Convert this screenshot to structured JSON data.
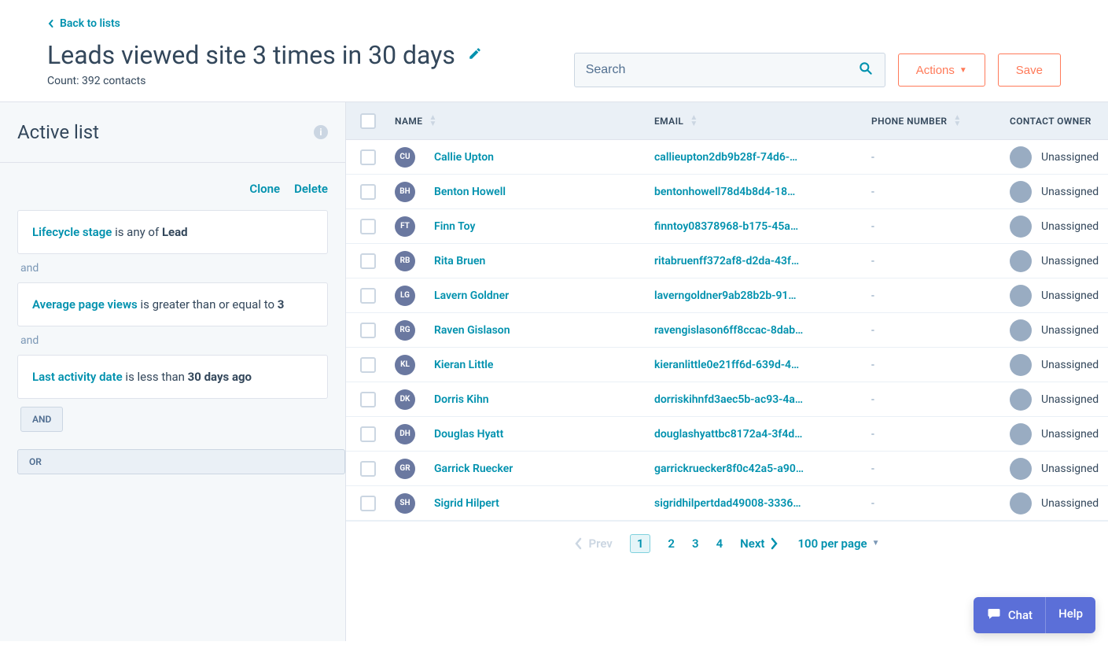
{
  "header": {
    "back_label": "Back to lists",
    "title": "Leads viewed site 3 times in 30 days",
    "count_text": "Count: 392 contacts",
    "search_placeholder": "Search",
    "actions_label": "Actions",
    "save_label": "Save"
  },
  "sidebar": {
    "title": "Active list",
    "clone_label": "Clone",
    "delete_label": "Delete",
    "filters": [
      {
        "property": "Lifecycle stage",
        "operator": " is any of ",
        "value": "Lead"
      },
      {
        "property": "Average page views",
        "operator": " is greater than or equal to ",
        "value": "3"
      },
      {
        "property": "Last activity date",
        "operator": " is less than ",
        "value": "30 days ago"
      }
    ],
    "connector_and": "and",
    "add_and_label": "AND",
    "add_or_label": "OR"
  },
  "table": {
    "columns": {
      "name": "NAME",
      "email": "EMAIL",
      "phone": "PHONE NUMBER",
      "owner": "CONTACT OWNER"
    },
    "rows": [
      {
        "initials": "CU",
        "name": "Callie Upton",
        "email": "callieupton2db9b28f-74d6-…",
        "phone": "-",
        "owner": "Unassigned"
      },
      {
        "initials": "BH",
        "name": "Benton Howell",
        "email": "bentonhowell78d4b8d4-18…",
        "phone": "-",
        "owner": "Unassigned"
      },
      {
        "initials": "FT",
        "name": "Finn Toy",
        "email": "finntoy08378968-b175-45a…",
        "phone": "-",
        "owner": "Unassigned"
      },
      {
        "initials": "RB",
        "name": "Rita Bruen",
        "email": "ritabruenff372af8-d2da-43f…",
        "phone": "-",
        "owner": "Unassigned"
      },
      {
        "initials": "LG",
        "name": "Lavern Goldner",
        "email": "laverngoldner9ab28b2b-91…",
        "phone": "-",
        "owner": "Unassigned"
      },
      {
        "initials": "RG",
        "name": "Raven Gislason",
        "email": "ravengislason6ff8ccac-8dab…",
        "phone": "-",
        "owner": "Unassigned"
      },
      {
        "initials": "KL",
        "name": "Kieran Little",
        "email": "kieranlittle0e21ff6d-639d-4…",
        "phone": "-",
        "owner": "Unassigned"
      },
      {
        "initials": "DK",
        "name": "Dorris Kihn",
        "email": "dorriskihnfd3aec5b-ac93-4a…",
        "phone": "-",
        "owner": "Unassigned"
      },
      {
        "initials": "DH",
        "name": "Douglas Hyatt",
        "email": "douglashyattbc8172a4-3f4d…",
        "phone": "-",
        "owner": "Unassigned"
      },
      {
        "initials": "GR",
        "name": "Garrick Ruecker",
        "email": "garrickruecker8f0c42a5-a90…",
        "phone": "-",
        "owner": "Unassigned"
      },
      {
        "initials": "SH",
        "name": "Sigrid Hilpert",
        "email": "sigridhilpertdad49008-3336…",
        "phone": "-",
        "owner": "Unassigned"
      }
    ]
  },
  "pagination": {
    "prev": "Prev",
    "pages": [
      "1",
      "2",
      "3",
      "4"
    ],
    "current": "1",
    "next": "Next",
    "per_page": "100 per page"
  },
  "floating": {
    "chat": "Chat",
    "help": "Help"
  }
}
